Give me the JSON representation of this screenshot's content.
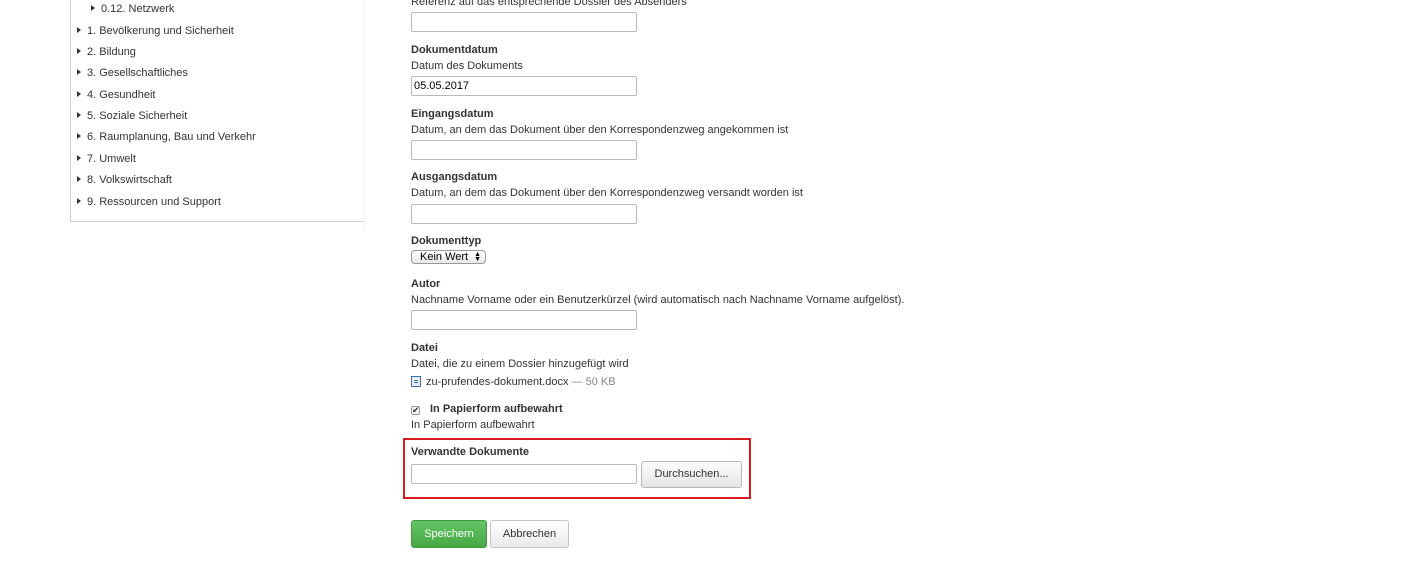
{
  "sidebar": {
    "subitem": "0.12. Netzwerk",
    "items": [
      "1. Bevölkerung und Sicherheit",
      "2. Bildung",
      "3. Gesellschaftliches",
      "4. Gesundheit",
      "5. Soziale Sicherheit",
      "6. Raumplanung, Bau und Verkehr",
      "7. Umwelt",
      "8. Volkswirtschaft",
      "9. Ressourcen und Support"
    ]
  },
  "form": {
    "referenz": {
      "help": "Referenz auf das entsprechende Dossier des Absenders",
      "value": ""
    },
    "dokumentdatum": {
      "label": "Dokumentdatum",
      "help": "Datum des Dokuments",
      "value": "05.05.2017"
    },
    "eingangsdatum": {
      "label": "Eingangsdatum",
      "help": "Datum, an dem das Dokument über den Korrespondenzweg angekommen ist",
      "value": ""
    },
    "ausgangsdatum": {
      "label": "Ausgangsdatum",
      "help": "Datum, an dem das Dokument über den Korrespondenzweg versandt worden ist",
      "value": ""
    },
    "dokumenttyp": {
      "label": "Dokumenttyp",
      "selected": "Kein Wert"
    },
    "autor": {
      "label": "Autor",
      "help": "Nachname Vorname oder ein Benutzerkürzel (wird automatisch nach Nachname Vorname aufgelöst).",
      "value": ""
    },
    "datei": {
      "label": "Datei",
      "help": "Datei, die zu einem Dossier hinzugefügt wird",
      "filename": "zu-prufendes-dokument.docx",
      "size": "— 50 KB"
    },
    "papierform": {
      "label": "In Papierform aufbewahrt",
      "help": "In Papierform aufbewahrt",
      "checked": true,
      "check_glyph": "✔"
    },
    "verwandte": {
      "label": "Verwandte Dokumente",
      "value": "",
      "browse_label": "Durchsuchen..."
    }
  },
  "actions": {
    "save_label": "Speichern",
    "cancel_label": "Abbrechen"
  },
  "colors": {
    "highlight": "#d71920",
    "save_button": "#5cb85c"
  }
}
